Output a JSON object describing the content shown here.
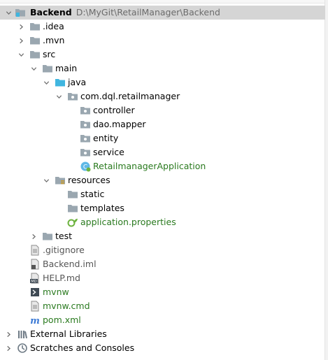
{
  "project_tree": {
    "root": {
      "label": "Backend",
      "path": "D:\\MyGit\\RetailManager\\Backend"
    },
    "idea": ".idea",
    "mvn": ".mvn",
    "src": "src",
    "main": "main",
    "java": "java",
    "package": "com.dql.retailmanager",
    "controller": "controller",
    "dao_mapper": "dao.mapper",
    "entity": "entity",
    "service": "service",
    "app_class": "RetailmanagerApplication",
    "resources": "resources",
    "static": "static",
    "templates": "templates",
    "app_properties": "application.properties",
    "test": "test",
    "gitignore": ".gitignore",
    "backend_iml": "Backend.iml",
    "help_md": "HELP.md",
    "mvnw": "mvnw",
    "mvnw_cmd": "mvnw.cmd",
    "pom_xml": "pom.xml",
    "external_libraries": "External Libraries",
    "scratches": "Scratches and Consoles"
  },
  "icons": {
    "folder": "folder-icon",
    "source_folder": "source-folder-icon",
    "resources_folder": "resources-folder-icon",
    "package": "package-icon",
    "spring_class": "spring-boot-class-icon",
    "properties": "spring-properties-icon",
    "text_file": "text-file-icon",
    "iml": "module-file-icon",
    "markdown": "markdown-file-icon",
    "shell": "shell-script-icon",
    "maven": "maven-icon",
    "libraries": "libraries-icon",
    "scratches": "scratches-icon"
  },
  "colors": {
    "selection": "#d5d5d5",
    "spring_text": "#2a7a1f",
    "path_text": "#6b6b6b",
    "folder": "#9aa7b0",
    "source_folder": "#40b6e0",
    "maven": "#3d7bd6"
  }
}
